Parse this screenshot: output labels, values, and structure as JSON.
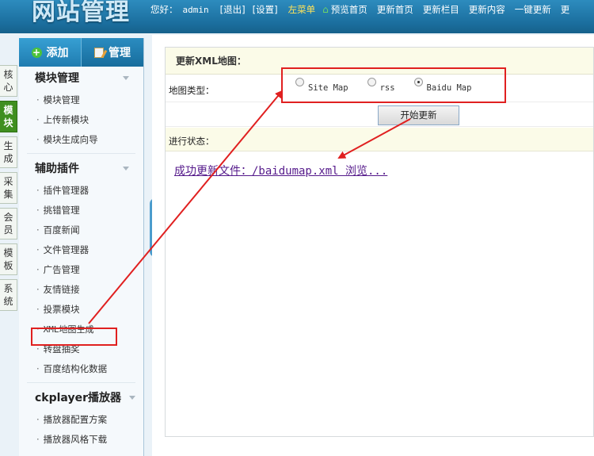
{
  "header": {
    "logo_text": "网站管理",
    "greeting": "您好：",
    "username": "admin",
    "logout": "[退出]",
    "settings": "[设置]",
    "left_menu": "左菜单",
    "nav": [
      "预览首页",
      "更新首页",
      "更新栏目",
      "更新内容",
      "一键更新",
      "更"
    ]
  },
  "vtabs": [
    {
      "label": "核心",
      "active": false
    },
    {
      "label": "模块",
      "active": true
    },
    {
      "label": "生成",
      "active": false
    },
    {
      "label": "采集",
      "active": false
    },
    {
      "label": "会员",
      "active": false
    },
    {
      "label": "模板",
      "active": false
    },
    {
      "label": "系统",
      "active": false
    }
  ],
  "sidebar": {
    "add_label": "添加",
    "manage_label": "管理",
    "groups": [
      {
        "title": "模块管理",
        "items": [
          "模块管理",
          "上传新模块",
          "模块生成向导"
        ]
      },
      {
        "title": "辅助插件",
        "items": [
          "插件管理器",
          "挑错管理",
          "百度新闻",
          "文件管理器",
          "广告管理",
          "友情链接",
          "投票模块",
          "XML地图生成",
          "转盘抽奖",
          "百度结构化数据"
        ]
      },
      {
        "title": "ckplayer播放器",
        "items": [
          "播放器配置方案",
          "播放器风格下载"
        ]
      }
    ]
  },
  "main": {
    "panel_title": "更新XML地图：",
    "map_type_label": "地图类型：",
    "radio_options": [
      {
        "label": "Site Map",
        "selected": false
      },
      {
        "label": "rss",
        "selected": false
      },
      {
        "label": "Baidu Map",
        "selected": true
      }
    ],
    "start_button": "开始更新",
    "status_label": "进行状态：",
    "result_text": "成功更新文件：/baidumap.xml 浏览..."
  },
  "colors": {
    "annotation": "#e02020",
    "active_tab": "#3f8f1f",
    "topbar": "#1b6e9e"
  }
}
